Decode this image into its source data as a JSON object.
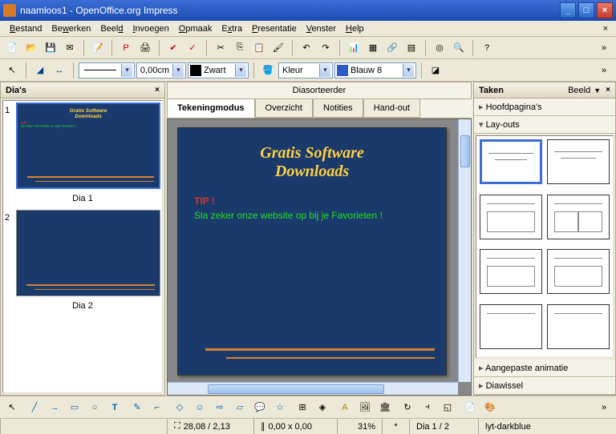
{
  "title": "naamloos1 - OpenOffice.org Impress",
  "menu": [
    "Bestand",
    "Bewerken",
    "Beeld",
    "Invoegen",
    "Opmaak",
    "Extra",
    "Presentatie",
    "Venster",
    "Help"
  ],
  "toolbar2": {
    "line_width": "0,00cm",
    "line_color_label": "Zwart",
    "fill_type": "Kleur",
    "fill_color": "Blauw 8"
  },
  "panels": {
    "slides_title": "Dia's",
    "tasks_title": "Taken",
    "tasks_view_label": "Beeld"
  },
  "slides": [
    {
      "num": "1",
      "label": "Dia 1"
    },
    {
      "num": "2",
      "label": "Dia 2"
    }
  ],
  "center": {
    "sorter_tab": "Diasorteerder",
    "tabs": [
      "Tekeningmodus",
      "Overzicht",
      "Notities",
      "Hand-out"
    ],
    "active_tab": 0
  },
  "slide_content": {
    "title1": "Gratis Software",
    "title2": "Downloads",
    "tip_label": "TIP !",
    "tip_text": "Sla zeker onze website op bij je Favorieten !"
  },
  "tasks": {
    "master": "Hoofdpagina's",
    "layouts": "Lay-outs",
    "anim": "Aangepaste animatie",
    "transition": "Diawissel"
  },
  "status": {
    "coords": "28,08 / 2,13",
    "size": "0,00 x 0,00",
    "zoom": "31%",
    "star": "*",
    "slide": "Dia 1 / 2",
    "template": "lyt-darkblue"
  }
}
